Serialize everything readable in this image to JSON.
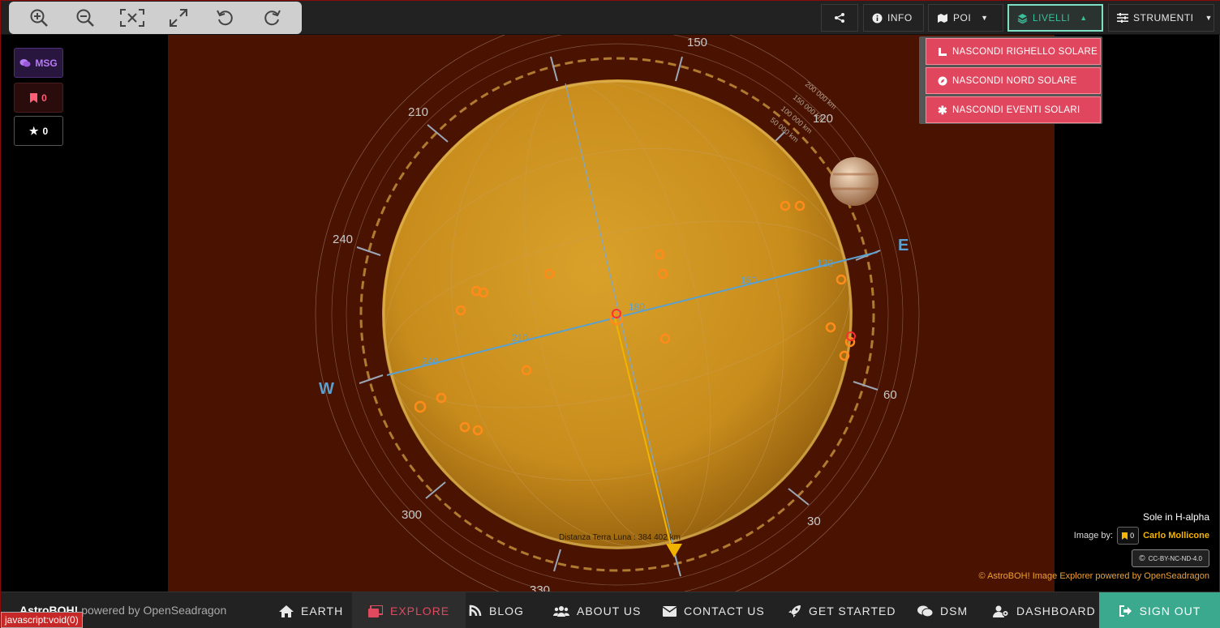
{
  "toolbar": {
    "zoom_buttons": [
      "zoom-in-icon",
      "zoom-out-icon",
      "reset-zoom-icon",
      "fullscreen-icon",
      "rotate-left-icon",
      "rotate-right-icon"
    ],
    "info_label": "INFO",
    "poi_label": "POI",
    "livelli_label": "LIVELLI",
    "strumenti_label": "STRUMENTI"
  },
  "dropdown": {
    "items": [
      {
        "label": "NASCONDI RIGHELLO SOLARE",
        "icon": "ruler-icon"
      },
      {
        "label": "NASCONDI NORD SOLARE",
        "icon": "compass-icon"
      },
      {
        "label": "NASCONDI EVENTI SOLARI",
        "icon": "asterisk-icon"
      }
    ]
  },
  "left": {
    "msg_label": "MSG",
    "bookmark_count": "0",
    "star_count": "0"
  },
  "image": {
    "angle_labels": [
      "150",
      "120",
      "60",
      "30",
      "330",
      "300",
      "240",
      "210"
    ],
    "dir_east": "E",
    "dir_west": "W",
    "ruler_labels": [
      "200 000 km",
      "150 000 km",
      "100 000 km",
      "50 000 km"
    ],
    "meridian_labels": [
      "120",
      "150",
      "180",
      "210",
      "240"
    ],
    "distance_text": "Distanza Terra Luna : 384 402 km"
  },
  "credits": {
    "caption": "Sole in H-alpha",
    "image_by": "Image by:",
    "bookmark_count": "0",
    "author": "Carlo Mollicone",
    "license": "CC-BY-NC-ND-4.0",
    "powered": "© AstroBOH! Image Explorer powered by OpenSeadragon"
  },
  "nav": {
    "brand": "AstroBOH!",
    "brand_suffix": " powered by OpenSeadragon",
    "items": [
      "EARTH",
      "EXPLORE",
      "BLOG",
      "ABOUT US",
      "CONTACT US",
      "GET STARTED",
      "DSM",
      "DASHBOARD"
    ],
    "signout": "SIGN OUT"
  },
  "status": "javascript:void(0)",
  "colors": {
    "accent": "#3bbf9a",
    "menu_item": "#e0475e",
    "explore": "#e04a5f",
    "signout": "#3aa98e"
  }
}
